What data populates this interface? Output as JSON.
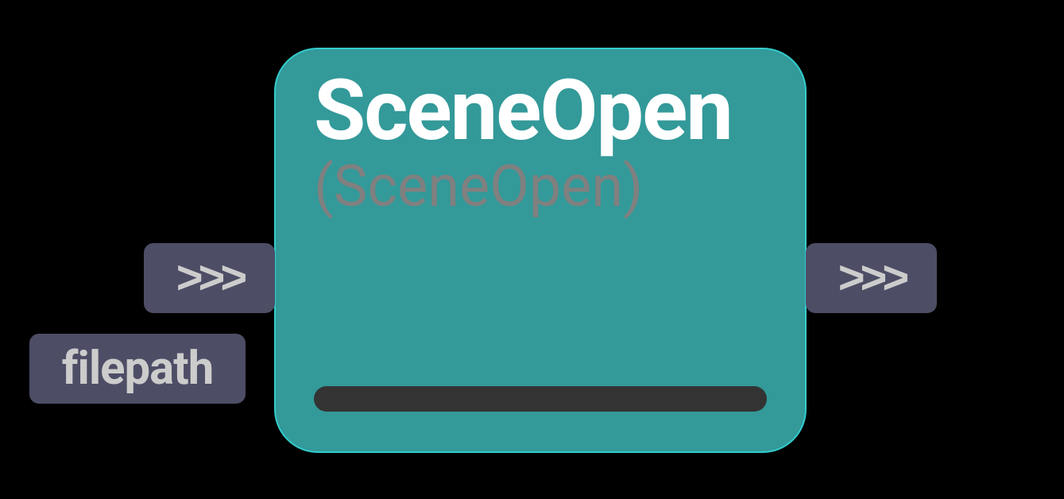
{
  "node": {
    "title": "SceneOpen",
    "subtitle": "(SceneOpen)"
  },
  "ports": {
    "input_exec": ">>>",
    "output_exec": ">>>",
    "filepath": "filepath"
  }
}
